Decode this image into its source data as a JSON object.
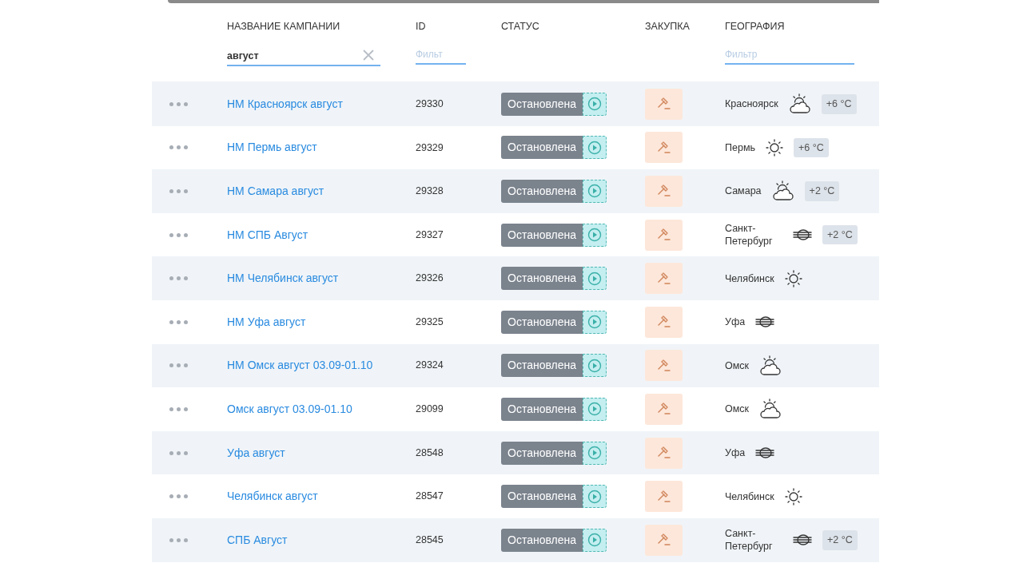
{
  "columns": [
    "НАЗВАНИЕ КАМПАНИИ",
    "ID",
    "СТАТУС",
    "ЗАКУПКА",
    "ГЕОГРАФИЯ"
  ],
  "filters": {
    "name": {
      "value": "август"
    },
    "id": {
      "placeholder": "Фильт"
    },
    "geo": {
      "placeholder": "Фильтр"
    }
  },
  "rows": [
    {
      "name": "НМ Красноярск август",
      "id": "29330",
      "status": "Остановлена",
      "city": "Красноярск",
      "kind": "cloud",
      "temp": "+6 °C"
    },
    {
      "name": "НМ Пермь август",
      "id": "29329",
      "status": "Остановлена",
      "city": "Пермь",
      "kind": "sun",
      "temp": "+6 °C"
    },
    {
      "name": "НМ Самара август",
      "id": "29328",
      "status": "Остановлена",
      "city": "Самара",
      "kind": "cloud",
      "temp": "+2 °C"
    },
    {
      "name": "НМ СПБ Август",
      "id": "29327",
      "status": "Остановлена",
      "city": "Санкт-Петербург",
      "kind": "fog",
      "temp": "+2 °C"
    },
    {
      "name": "НМ Челябинск август",
      "id": "29326",
      "status": "Остановлена",
      "city": "Челябинск",
      "kind": "sun"
    },
    {
      "name": "НМ Уфа август",
      "id": "29325",
      "status": "Остановлена",
      "city": "Уфа",
      "kind": "fog"
    },
    {
      "name": "НМ Омск август 03.09-01.10",
      "id": "29324",
      "status": "Остановлена",
      "city": "Омск",
      "kind": "cloud"
    },
    {
      "name": "Омск август 03.09-01.10",
      "id": "29099",
      "status": "Остановлена",
      "city": "Омск",
      "kind": "cloud"
    },
    {
      "name": "Уфа август",
      "id": "28548",
      "status": "Остановлена",
      "city": "Уфа",
      "kind": "fog"
    },
    {
      "name": "Челябинск август",
      "id": "28547",
      "status": "Остановлена",
      "city": "Челябинск",
      "kind": "sun"
    },
    {
      "name": "СПБ Август",
      "id": "28545",
      "status": "Остановлена",
      "city": "Санкт-Петербург",
      "kind": "fog",
      "temp": "+2 °C"
    }
  ]
}
